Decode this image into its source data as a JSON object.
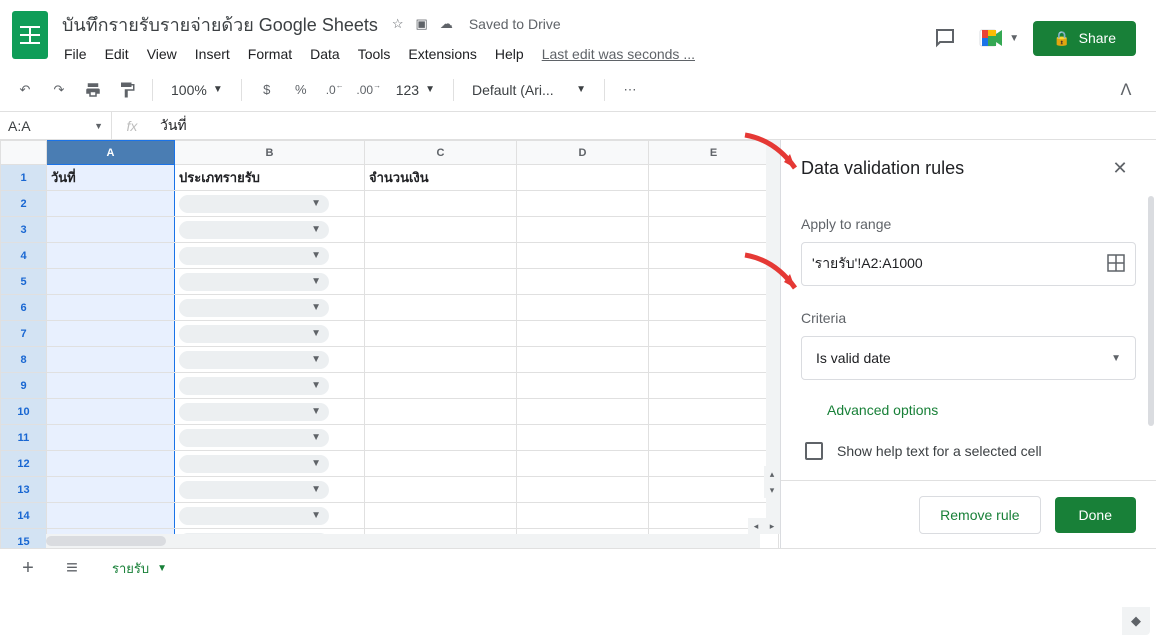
{
  "header": {
    "title": "บันทึกรายรับรายจ่ายด้วย Google Sheets",
    "saved_status": "Saved to Drive",
    "last_edit": "Last edit was seconds ...",
    "share_label": "Share"
  },
  "menus": [
    "File",
    "Edit",
    "View",
    "Insert",
    "Format",
    "Data",
    "Tools",
    "Extensions",
    "Help"
  ],
  "toolbar": {
    "zoom": "100%",
    "currency": "$",
    "percent": "%",
    "dec_dec": ".0",
    "inc_dec": ".00",
    "num_format": "123",
    "font": "Default (Ari..."
  },
  "formula": {
    "name_box": "A:A",
    "value": "วันที่"
  },
  "columns": [
    "A",
    "B",
    "C",
    "D",
    "E"
  ],
  "rows": [
    1,
    2,
    3,
    4,
    5,
    6,
    7,
    8,
    9,
    10,
    11,
    12,
    13,
    14,
    15
  ],
  "header_row": {
    "A": "วันที่",
    "B": "ประเภทรายรับ",
    "C": "จำนวนเงิน"
  },
  "sidebar": {
    "title": "Data validation rules",
    "apply_label": "Apply to range",
    "range_value": "'รายรับ'!A2:A1000",
    "criteria_label": "Criteria",
    "criteria_value": "Is valid date",
    "advanced": "Advanced options",
    "help_text_label": "Show help text for a selected cell",
    "remove_label": "Remove rule",
    "done_label": "Done"
  },
  "sheet_tab": {
    "name": "รายรับ"
  }
}
